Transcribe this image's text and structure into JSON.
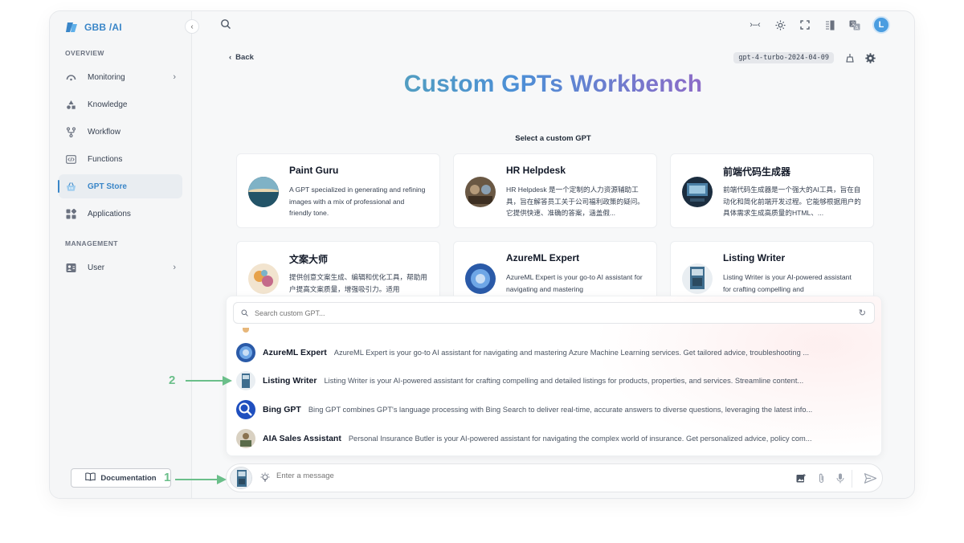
{
  "app": {
    "brand_name": "GBB",
    "brand_suffix": "AI"
  },
  "sidebar": {
    "overview_label": "OVERVIEW",
    "management_label": "MANAGEMENT",
    "items": [
      {
        "label": "Monitoring",
        "icon": "gauge-icon",
        "has_chevron": true
      },
      {
        "label": "Knowledge",
        "icon": "shapes-icon"
      },
      {
        "label": "Workflow",
        "icon": "branch-icon"
      },
      {
        "label": "Functions",
        "icon": "code-icon"
      },
      {
        "label": "GPT Store",
        "icon": "basket-icon",
        "active": true
      },
      {
        "label": "Applications",
        "icon": "apps-grid-icon"
      }
    ],
    "management_items": [
      {
        "label": "User",
        "icon": "user-card-icon",
        "has_chevron": true
      }
    ],
    "documentation_label": "Documentation"
  },
  "header": {
    "back_label": "Back",
    "model": "gpt-4-turbo-2024-04-09",
    "title": "Custom GPTs Workbench",
    "select_label": "Select a custom GPT"
  },
  "cards": [
    {
      "name": "Paint Guru",
      "desc": "A GPT specialized in generating and refining images with a mix of professional and friendly tone."
    },
    {
      "name": "HR Helpdesk",
      "desc": "HR Helpdesk 是一个定制的人力资源辅助工具，旨在解答员工关于公司福利政策的疑问。它提供快速、准确的答案，涵盖假..."
    },
    {
      "name": "前端代码生成器",
      "desc": "前端代码生成器是一个强大的AI工具，旨在自动化和简化前端开发过程。它能够根据用户的具体需求生成高质量的HTML、..."
    },
    {
      "name": "文案大师",
      "desc": "提供创意文案生成、编辑和优化工具，帮助用户提高文案质量，增强吸引力。适用"
    },
    {
      "name": "AzureML Expert",
      "desc": "AzureML Expert is your go-to AI assistant for navigating and mastering"
    },
    {
      "name": "Listing Writer",
      "desc": "Listing Writer is your AI-powered assistant for crafting compelling and"
    }
  ],
  "dropdown": {
    "search_placeholder": "Search custom GPT...",
    "rows": [
      {
        "name": "AzureML Expert",
        "desc": "AzureML Expert is your go-to AI assistant for navigating and mastering Azure Machine Learning services. Get tailored advice, troubleshooting ..."
      },
      {
        "name": "Listing Writer",
        "desc": "Listing Writer is your AI-powered assistant for crafting compelling and detailed listings for products, properties, and services. Streamline content..."
      },
      {
        "name": "Bing GPT",
        "desc": "Bing GPT combines GPT's language processing with Bing Search to deliver real-time, accurate answers to diverse questions, leveraging the latest info..."
      },
      {
        "name": "AIA Sales Assistant",
        "desc": "Personal Insurance Butler is your AI-powered assistant for navigating the complex world of insurance. Get personalized advice, policy com..."
      }
    ]
  },
  "composer": {
    "placeholder": "Enter a message"
  },
  "user": {
    "avatar_initial": "L"
  },
  "annotations": {
    "one": "1",
    "two": "2"
  },
  "colors": {
    "accent": "#3a86c8",
    "annotation": "#6bbf8a"
  }
}
